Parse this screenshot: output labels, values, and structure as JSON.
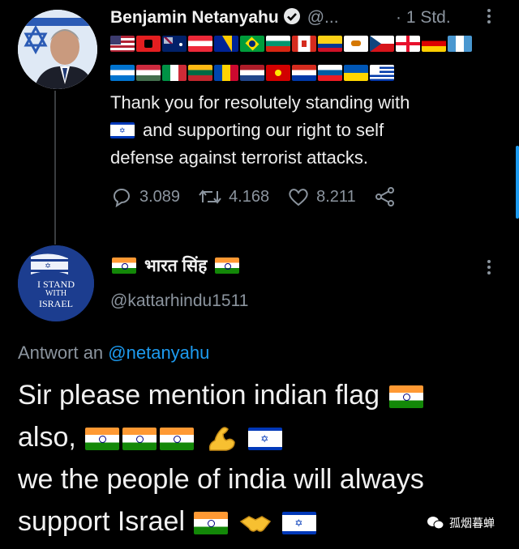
{
  "tweet1": {
    "author_name": "Benjamin Netanyahu",
    "handle": "@...",
    "time": "· 1 Std.",
    "text": "Thank you for resolutely standing with",
    "text_line2": "and supporting our right to self",
    "text_line3": "defense against terrorist attacks.",
    "replies": "3.089",
    "retweets": "4.168",
    "likes": "8.211"
  },
  "tweet2": {
    "author_name": "भारत सिंह",
    "handle": "@kattarhindu1511",
    "avatar_text_1": "I STAND",
    "avatar_text_2": "WITH",
    "avatar_text_3": "ISRAEL",
    "reply_prefix": "Antwort an",
    "reply_to": "@netanyahu",
    "line1": "Sir please mention indian flag",
    "line2": "also,",
    "line3": "we the people of india will always",
    "line4": "support Israel"
  },
  "watermark": "孤烟暮蝉",
  "icons": {
    "verified": "verified-badge-icon",
    "reply": "reply-icon",
    "retweet": "retweet-icon",
    "like": "heart-icon",
    "share": "share-icon",
    "more": "more-vertical-icon"
  },
  "colors": {
    "background": "#000000",
    "link": "#1d9bf0",
    "secondary_text": "#8b949e"
  }
}
